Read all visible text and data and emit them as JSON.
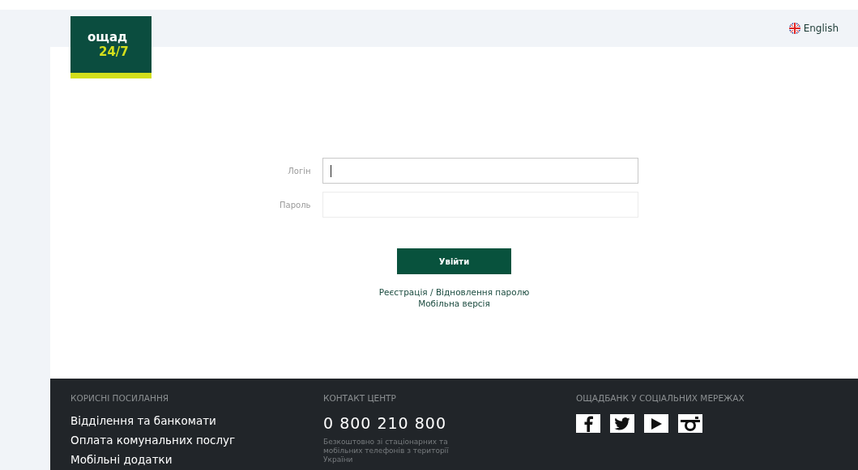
{
  "header": {
    "logo": {
      "line_1": "ощад",
      "line_2": "24/7"
    },
    "language": "English"
  },
  "login_form": {
    "fields": [
      {
        "label": "Логін",
        "focused": true
      },
      {
        "label": "Пароль",
        "focused": false
      }
    ],
    "submit": "Увійти",
    "links": [
      "Реєстрація / Відновлення паролю",
      "Мобільна версія"
    ]
  },
  "footer": {
    "useful_links": {
      "heading": "КОРИСНІ ПОСИЛАННЯ",
      "items": [
        "Відділення та банкомати",
        "Оплата комунальних послуг",
        "Мобільні додатки"
      ]
    },
    "contact_center": {
      "heading": "КОНТАКТ ЦЕНТР",
      "phone": "0 800 210 800",
      "note": "Безкоштовно зі стаціонарних та мобільних телефонів з території України"
    },
    "social": {
      "heading": "ОЩАДБАНК У СОЦІАЛЬНИХ МЕРЕЖАХ",
      "networks": [
        {
          "kind": "facebook"
        },
        {
          "kind": "twitter"
        },
        {
          "kind": "youtube"
        },
        {
          "kind": "instagram"
        }
      ]
    }
  }
}
